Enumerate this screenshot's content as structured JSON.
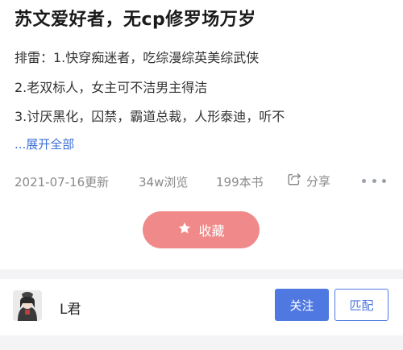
{
  "booklist": {
    "title": "苏文爱好者，无cp修罗场万岁",
    "description_lines": [
      "排雷：1.快穿痴迷者，吃综漫综英美综武侠",
      "2.老双标人，女主可不洁男主得洁",
      "3.讨厌黑化，囚禁，霸道总裁，人形泰迪，听不"
    ],
    "expand_label": "...展开全部",
    "updated": "2021-07-16更新",
    "views": "34w浏览",
    "book_count": "199本书",
    "share_label": "分享",
    "collect_label": "收藏"
  },
  "author": {
    "name": "L君",
    "follow_label": "关注",
    "match_label": "匹配"
  },
  "colors": {
    "accent_blue": "#4f78e0",
    "collect_pink": "#f08a8a",
    "link_blue": "#3d6fd6",
    "meta_gray": "#8a8a8a"
  },
  "icons": {
    "share": "share-icon",
    "collect": "star-icon",
    "more": "more-dots-icon"
  }
}
